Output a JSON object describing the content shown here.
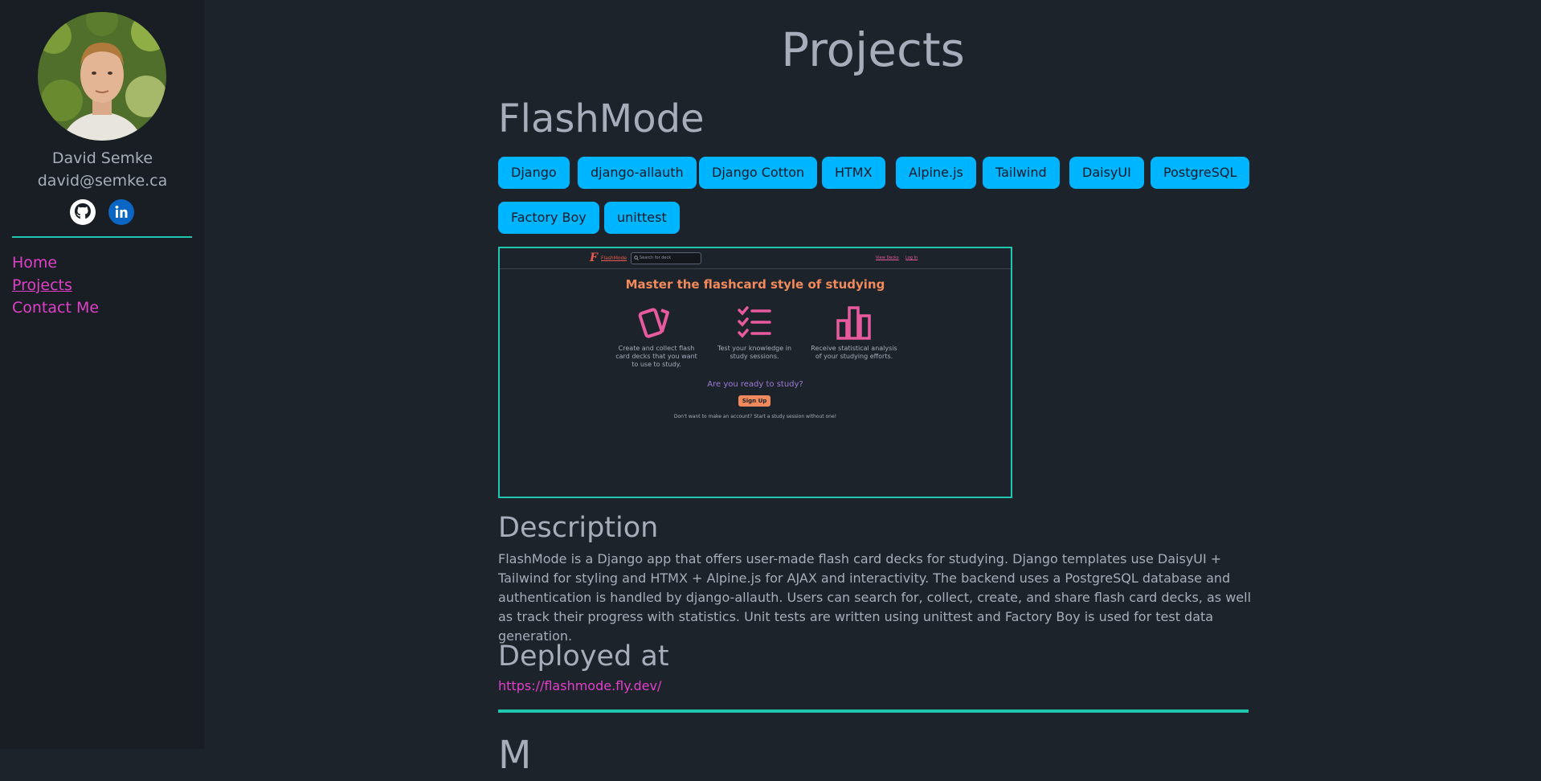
{
  "sidebar": {
    "name": "David Semke",
    "email": "david@semke.ca",
    "nav": [
      {
        "label": "Home"
      },
      {
        "label": "Projects"
      },
      {
        "label": "Contact Me"
      }
    ],
    "social": [
      "github-icon",
      "linkedin-icon"
    ]
  },
  "page": {
    "title": "Projects"
  },
  "project": {
    "title": "FlashMode",
    "tags": [
      "Django",
      "django-allauth",
      "Django Cotton",
      "HTMX",
      "Alpine.js",
      "Tailwind",
      "DaisyUI",
      "PostgreSQL",
      "Factory Boy",
      "unittest"
    ],
    "screenshot": {
      "brand": "FlashMode",
      "search_placeholder": "Search for deck",
      "nav_links": [
        "View Decks",
        "Log In"
      ],
      "heading": "Master the flashcard style of studying",
      "features": [
        "Create and collect flash card decks that you want to use to study.",
        "Test your knowledge in study sessions.",
        "Receive statistical analysis of your studying efforts."
      ],
      "ready": "Are you ready to study?",
      "signup": "Sign Up",
      "note": "Don't want to make an account? Start a study session without one!"
    },
    "description_heading": "Description",
    "description": "FlashMode is a Django app that offers user-made flash card decks for studying. Django templates use DaisyUI + Tailwind for styling and HTMX + Alpine.js for AJAX and interactivity. The backend uses a PostgreSQL database and authentication is handled by django-allauth. Users can search for, collect, create, and share flash card decks, as well as track their progress with statistics. Unit tests are written using unittest and Factory Boy is used for test data generation.",
    "deployed_heading": "Deployed at",
    "deployed_url": "https://flashmode.fly.dev/"
  },
  "next_project": {
    "title": "M"
  },
  "colors": {
    "background": "#1d232a",
    "sidebar": "#191e24",
    "accent": "#1fc7b0",
    "link": "#e040c8",
    "tag": "#00b5ff"
  }
}
